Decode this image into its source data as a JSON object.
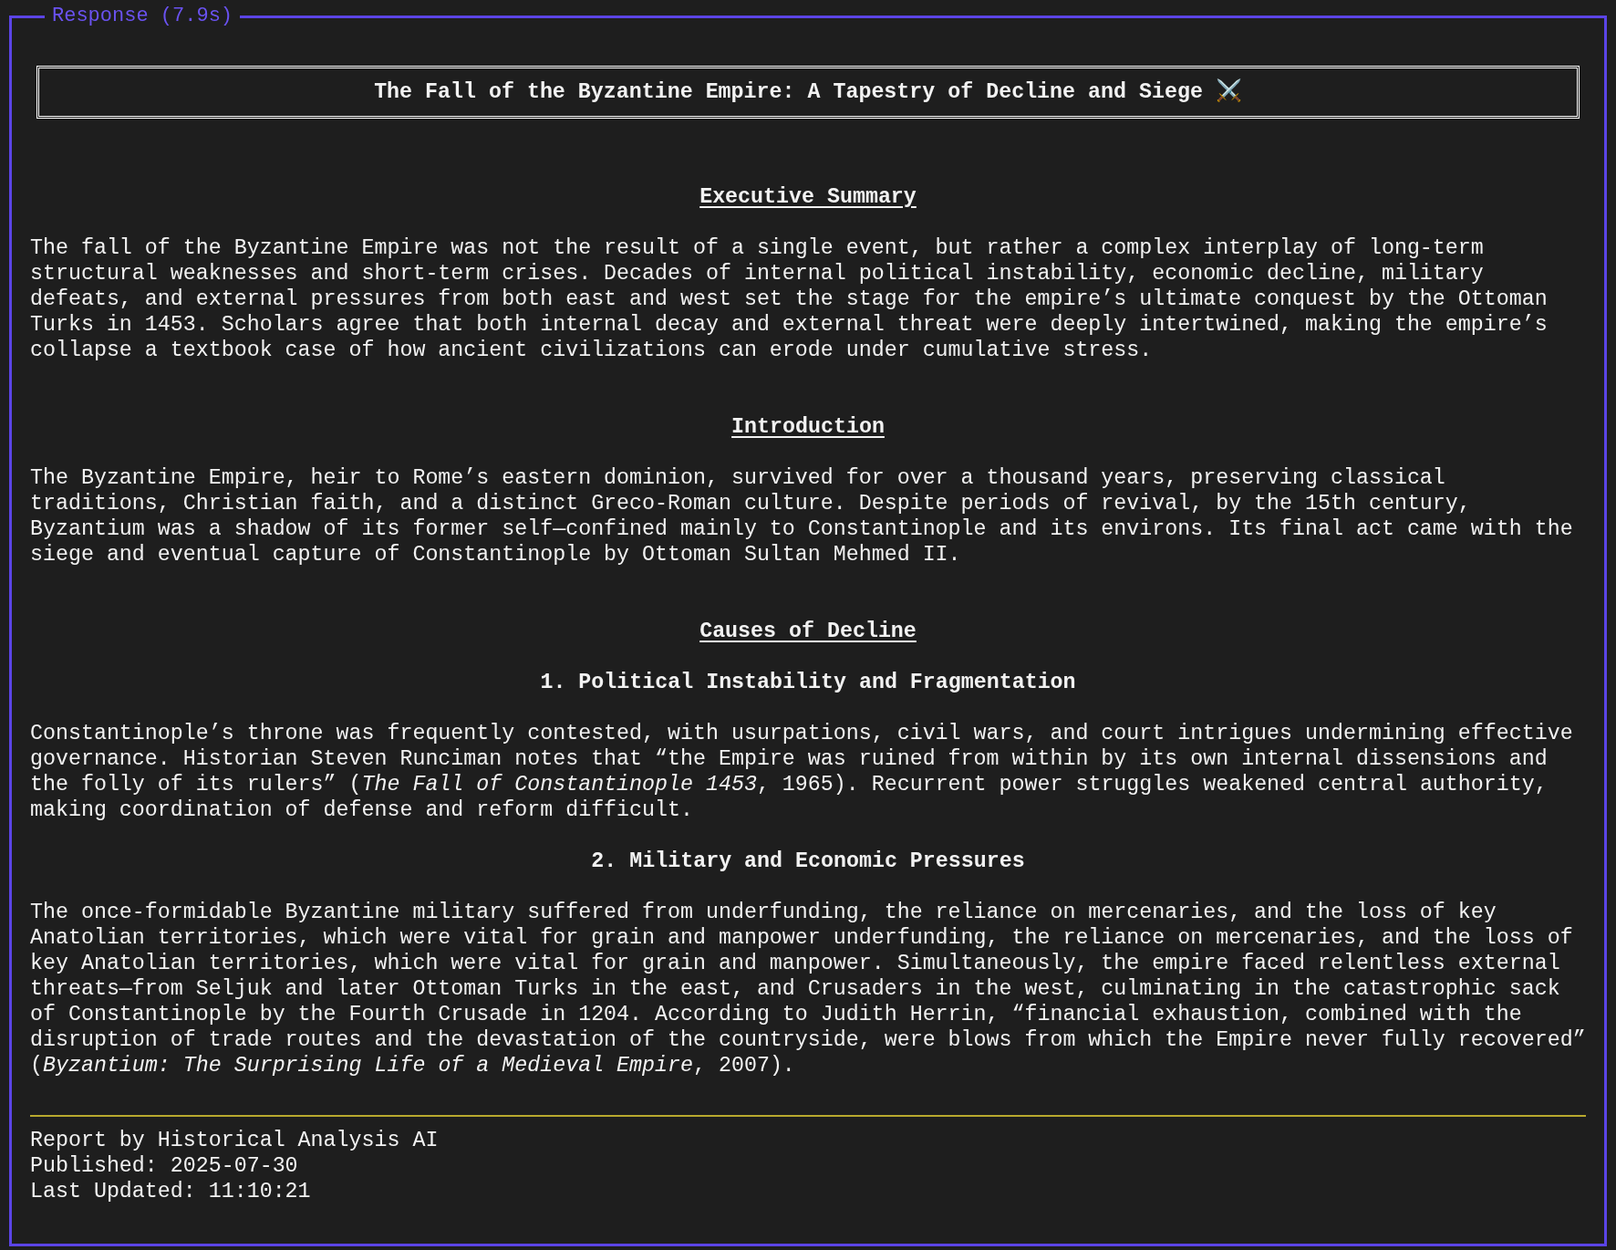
{
  "panel": {
    "title": "Response (7.9s)"
  },
  "report": {
    "title": "The Fall of the Byzantine Empire: A Tapestry of Decline and Siege ⚔️",
    "sections": [
      {
        "kind": "heading",
        "text": "Executive Summary"
      },
      {
        "kind": "paragraph",
        "text": "The fall of the Byzantine Empire was not the result of a single event, but rather a complex interplay of long-term\nstructural weaknesses and short-term crises. Decades of internal political instability, economic decline, military\ndefeats, and external pressures from both east and west set the stage for the empire’s ultimate conquest by the Ottoman\nTurks in 1453. Scholars agree that both internal decay and external threat were deeply intertwined, making the empire’s\ncollapse a textbook case of how ancient civilizations can erode under cumulative stress."
      },
      {
        "kind": "heading",
        "text": "Introduction"
      },
      {
        "kind": "paragraph",
        "text": "The Byzantine Empire, heir to Rome’s eastern dominion, survived for over a thousand years, preserving classical\ntraditions, Christian faith, and a distinct Greco-Roman culture. Despite periods of revival, by the 15th century,\nByzantium was a shadow of its former self—confined mainly to Constantinople and its environs. Its final act came with the\nsiege and eventual capture of Constantinople by Ottoman Sultan Mehmed II."
      },
      {
        "kind": "heading",
        "text": "Causes of Decline"
      },
      {
        "kind": "subheading",
        "text": "1. Political Instability and Fragmentation"
      },
      {
        "kind": "paragraph",
        "text": "Constantinople’s throne was frequently contested, with usurpations, civil wars, and court intrigues undermining effective\ngovernance. Historian Steven Runciman notes that “the Empire was ruined from within by its own internal dissensions and\nthe folly of its rulers” (*The Fall of Constantinople 1453*, 1965). Recurrent power struggles weakened central authority,\nmaking coordination of defense and reform difficult."
      },
      {
        "kind": "subheading",
        "text": "2. Military and Economic Pressures"
      },
      {
        "kind": "paragraph",
        "text": "The once-formidable Byzantine military suffered from underfunding, the reliance on mercenaries, and the loss of key\nAnatolian territories, which were vital for grain and manpower underfunding, the reliance on mercenaries, and the loss of\nkey Anatolian territories, which were vital for grain and manpower. Simultaneously, the empire faced relentless external\nthreats—from Seljuk and later Ottoman Turks in the east, and Crusaders in the west, culminating in the catastrophic sack\nof Constantinople by the Fourth Crusade in 1204. According to Judith Herrin, “financial exhaustion, combined with the\ndisruption of trade routes and the devastation of the countryside, were blows from which the Empire never fully recovered”\n(*Byzantium: The Surprising Life of a Medieval Empire*, 2007)."
      }
    ],
    "footer": [
      "Report by Historical Analysis AI",
      "Published: 2025-07-30",
      "Last Updated: 11:10:21"
    ]
  }
}
